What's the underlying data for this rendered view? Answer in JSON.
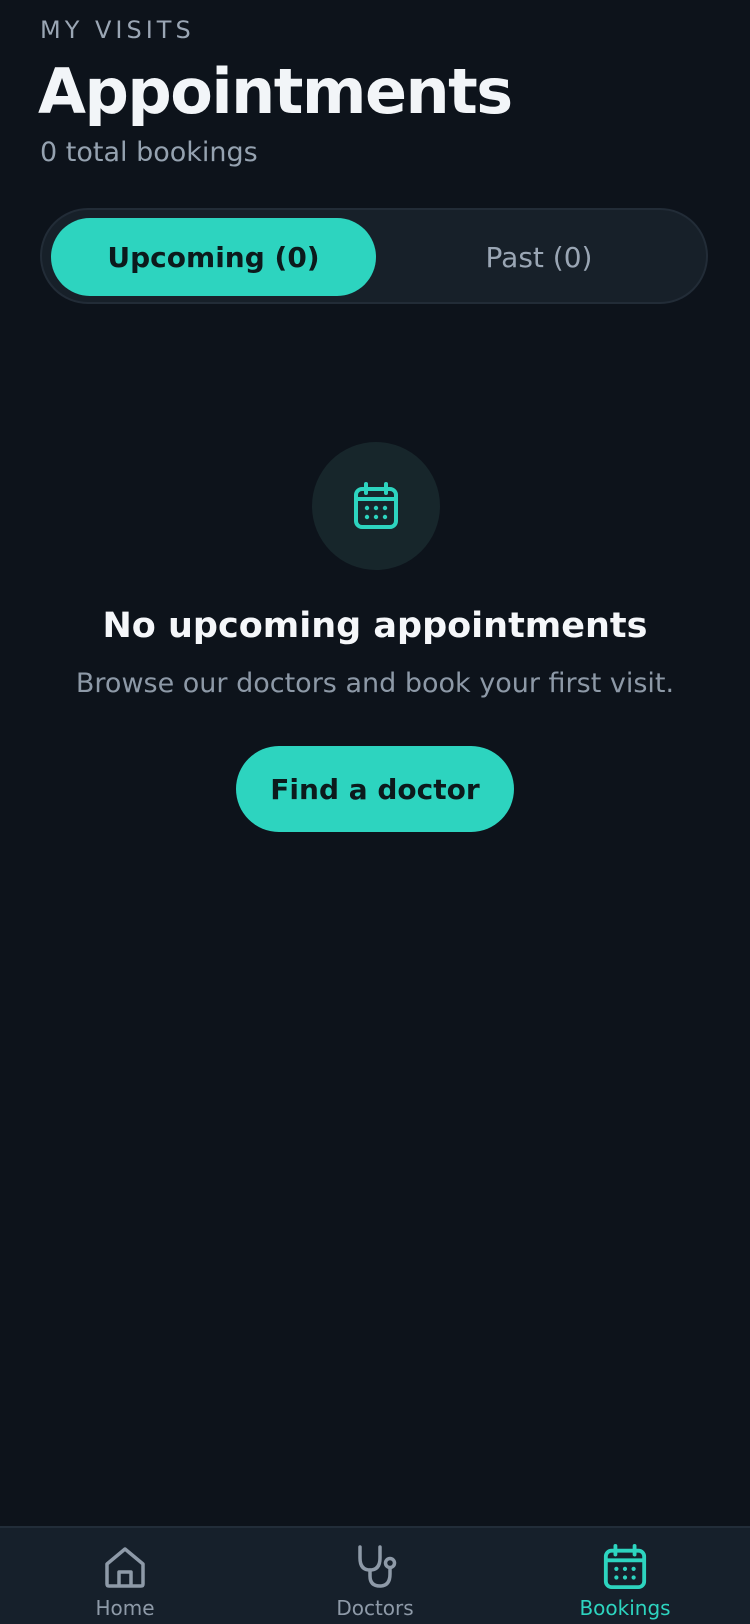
{
  "header": {
    "eyebrow": "MY VISITS",
    "title": "Appointments",
    "subtitle": "0 total bookings"
  },
  "tabs": [
    {
      "label": "Upcoming (0)",
      "active": true
    },
    {
      "label": "Past (0)",
      "active": false
    }
  ],
  "empty_state": {
    "icon": "calendar-icon",
    "title": "No upcoming appointments",
    "description": "Browse our doctors and book your first visit.",
    "cta_label": "Find a doctor"
  },
  "bottom_nav": [
    {
      "label": "Home",
      "icon": "home-icon",
      "active": false
    },
    {
      "label": "Doctors",
      "icon": "stethoscope-icon",
      "active": false
    },
    {
      "label": "Bookings",
      "icon": "calendar-icon",
      "active": true
    }
  ],
  "colors": {
    "background": "#0d131b",
    "accent": "#2dd4bf",
    "nav_background": "#16202b",
    "muted_text": "#9aa6b4"
  }
}
